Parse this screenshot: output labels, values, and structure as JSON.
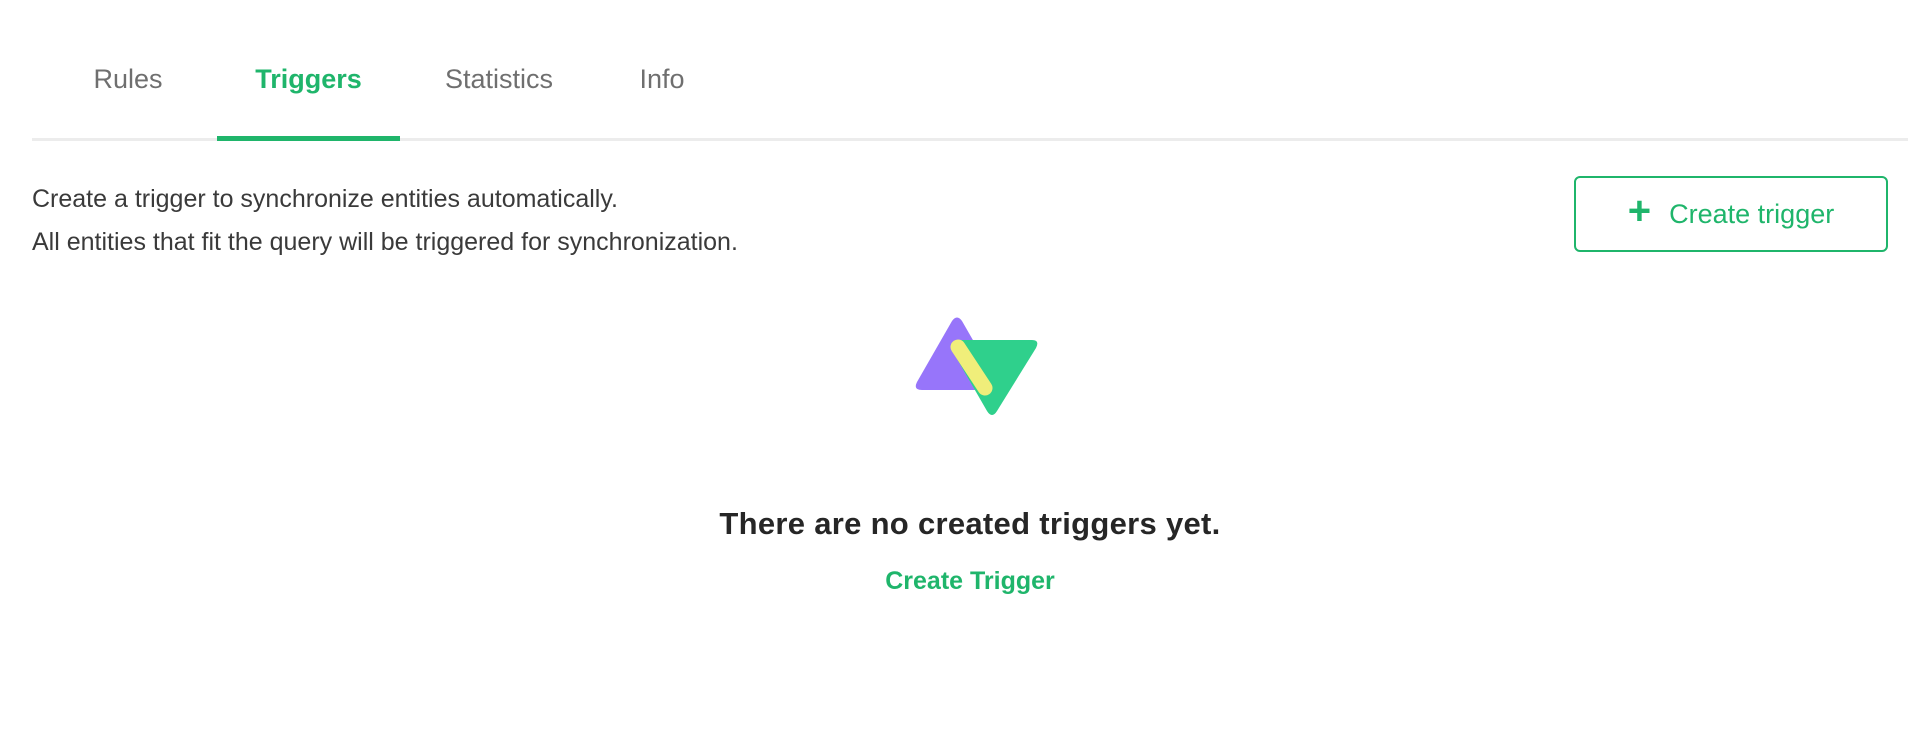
{
  "tabs": [
    {
      "label": "Rules",
      "active": false
    },
    {
      "label": "Triggers",
      "active": true
    },
    {
      "label": "Statistics",
      "active": false
    },
    {
      "label": "Info",
      "active": false
    }
  ],
  "description": {
    "line1": "Create a trigger to synchronize entities automatically.",
    "line2": "All entities that fit the query will be triggered for synchronization."
  },
  "toolbar": {
    "create_button_label": "Create trigger",
    "create_button_icon": "plus-icon"
  },
  "empty_state": {
    "illustration": "empty-triggers-illustration",
    "title": "There are no created triggers yet.",
    "link_label": "Create Trigger"
  },
  "colors": {
    "accent": "#1fb56b",
    "illustration_purple": "#9775fa",
    "illustration_green": "#2fd08c",
    "illustration_yellow": "#f0ee7a"
  }
}
